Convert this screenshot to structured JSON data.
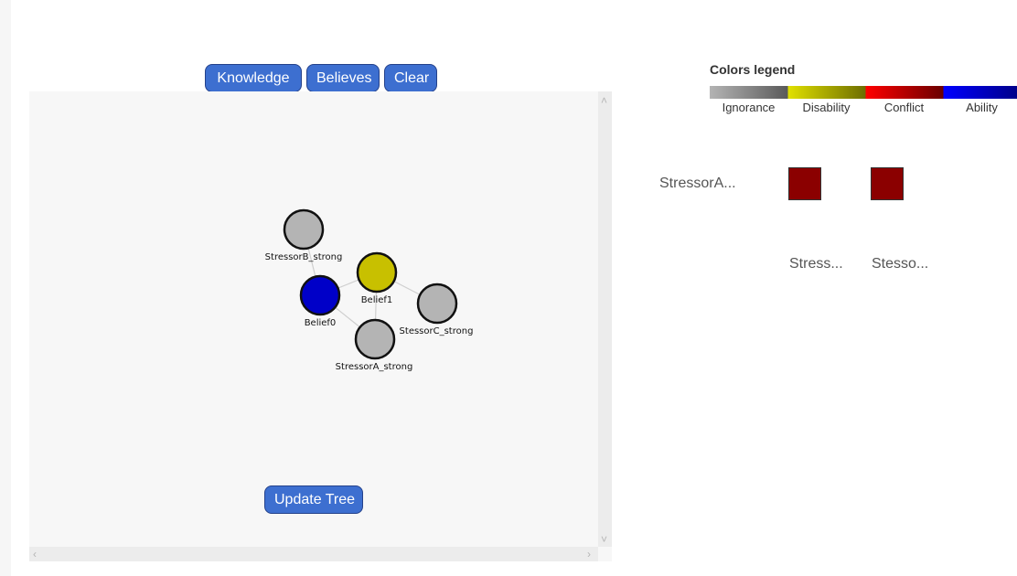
{
  "toolbar": {
    "knowledge_label": "Knowledge",
    "believes_label": "Believes",
    "clear_label": "Clear"
  },
  "graph": {
    "nodes": [
      {
        "id": "StressorB_strong",
        "label": "StressorB_strong",
        "color": "#b4b4b4"
      },
      {
        "id": "Belief1",
        "label": "Belief1",
        "color": "#c8c000"
      },
      {
        "id": "Belief0",
        "label": "Belief0",
        "color": "#0000c8"
      },
      {
        "id": "StessorC_strong",
        "label": "StessorC_strong",
        "color": "#b4b4b4"
      },
      {
        "id": "StressorA_strong",
        "label": "StressorA_strong",
        "color": "#b4b4b4"
      }
    ],
    "update_label": "Update Tree"
  },
  "legend": {
    "title": "Colors legend",
    "labels": [
      "Ignorance",
      "Disability",
      "Conflict",
      "Ability"
    ],
    "colors": [
      "#b4b4b4",
      "#e0e000",
      "#ff0000",
      "#0000ff"
    ]
  },
  "matrix": {
    "row_label": "StressorA...",
    "cell_color": "#8b0000",
    "col_labels": [
      "Stress...",
      "Stesso..."
    ]
  }
}
